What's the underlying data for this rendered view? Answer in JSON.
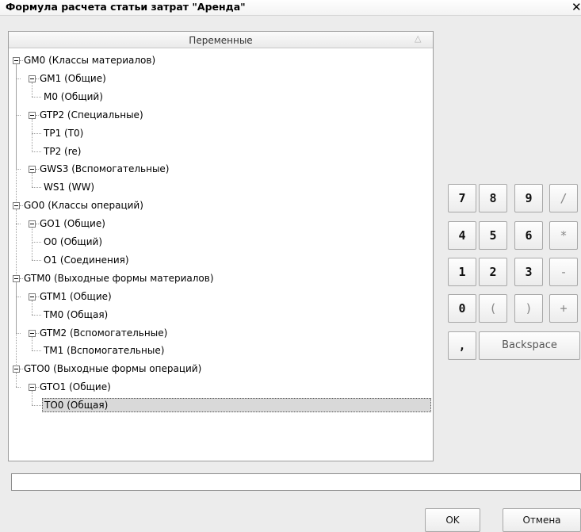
{
  "window": {
    "title": "Формула расчета статьи затрат \"Аренда\"",
    "close_glyph": "✕"
  },
  "tree": {
    "header": "Переменные",
    "sort_glyph": "△",
    "nodes": [
      {
        "label": "GM0 (Классы материалов)",
        "level": 0,
        "expandable": true,
        "selected": false
      },
      {
        "label": "GM1 (Общие)",
        "level": 1,
        "expandable": true,
        "selected": false
      },
      {
        "label": "M0 (Общий)",
        "level": 2,
        "expandable": false,
        "selected": false
      },
      {
        "label": "GTP2 (Специальные)",
        "level": 1,
        "expandable": true,
        "selected": false
      },
      {
        "label": "TP1 (T0)",
        "level": 2,
        "expandable": false,
        "selected": false
      },
      {
        "label": "TP2 (re)",
        "level": 2,
        "expandable": false,
        "selected": false
      },
      {
        "label": "GWS3 (Вспомогательные)",
        "level": 1,
        "expandable": true,
        "selected": false
      },
      {
        "label": "WS1 (WW)",
        "level": 2,
        "expandable": false,
        "selected": false
      },
      {
        "label": "GO0 (Классы операций)",
        "level": 0,
        "expandable": true,
        "selected": false
      },
      {
        "label": "GO1 (Общие)",
        "level": 1,
        "expandable": true,
        "selected": false
      },
      {
        "label": "O0 (Общий)",
        "level": 2,
        "expandable": false,
        "selected": false
      },
      {
        "label": "O1 (Соединения)",
        "level": 2,
        "expandable": false,
        "selected": false
      },
      {
        "label": "GTM0 (Выходные формы материалов)",
        "level": 0,
        "expandable": true,
        "selected": false
      },
      {
        "label": "GTM1 (Общие)",
        "level": 1,
        "expandable": true,
        "selected": false
      },
      {
        "label": "TM0 (Общая)",
        "level": 2,
        "expandable": false,
        "selected": false
      },
      {
        "label": "GTM2 (Вспомогательные)",
        "level": 1,
        "expandable": true,
        "selected": false
      },
      {
        "label": "TM1 (Вспомогательные)",
        "level": 2,
        "expandable": false,
        "selected": false
      },
      {
        "label": "GTO0 (Выходные формы операций)",
        "level": 0,
        "expandable": true,
        "selected": false
      },
      {
        "label": "GTO1 (Общие)",
        "level": 1,
        "expandable": true,
        "selected": false
      },
      {
        "label": "TO0 (Общая)",
        "level": 2,
        "expandable": false,
        "selected": true
      }
    ]
  },
  "keypad": {
    "rows": [
      [
        {
          "label": "7",
          "kind": "digit"
        },
        {
          "label": "8",
          "kind": "digit"
        },
        {
          "label": "9",
          "kind": "digit"
        },
        {
          "label": "/",
          "kind": "op"
        }
      ],
      [
        {
          "label": "4",
          "kind": "digit"
        },
        {
          "label": "5",
          "kind": "digit"
        },
        {
          "label": "6",
          "kind": "digit"
        },
        {
          "label": "*",
          "kind": "op"
        }
      ],
      [
        {
          "label": "1",
          "kind": "digit"
        },
        {
          "label": "2",
          "kind": "digit"
        },
        {
          "label": "3",
          "kind": "digit"
        },
        {
          "label": "-",
          "kind": "op"
        }
      ],
      [
        {
          "label": "0",
          "kind": "digit"
        },
        {
          "label": "(",
          "kind": "op"
        },
        {
          "label": ")",
          "kind": "op"
        },
        {
          "label": "+",
          "kind": "op"
        }
      ]
    ],
    "comma_label": ",",
    "backspace_label": "Backspace"
  },
  "formula": {
    "value": "",
    "placeholder": ""
  },
  "buttons": {
    "ok_label": "OK",
    "cancel_label": "Отмена"
  }
}
